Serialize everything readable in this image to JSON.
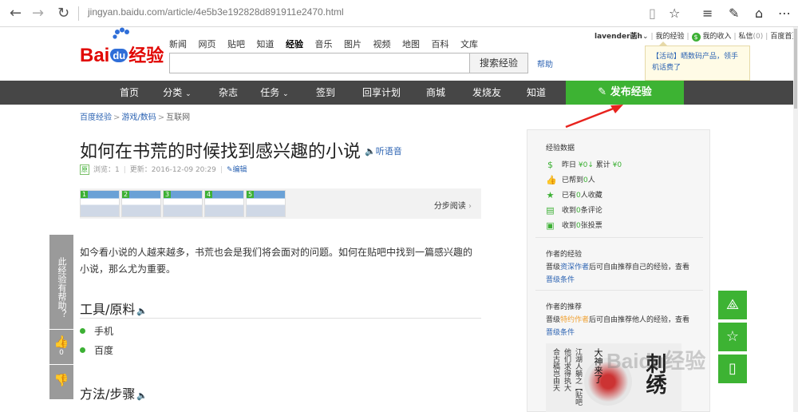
{
  "browser": {
    "url": "jingyan.baidu.com/article/4e5b3e192828d891911e2470.html"
  },
  "topnav": [
    "新闻",
    "网页",
    "贴吧",
    "知道",
    "经验",
    "音乐",
    "图片",
    "视频",
    "地图",
    "百科",
    "文库"
  ],
  "search": {
    "button": "搜索经验",
    "help": "帮助"
  },
  "logo": {
    "text_bai": "Bai",
    "text_du": "du",
    "text_jy": "经验"
  },
  "userbar": {
    "username": "lavender菡h",
    "my_experience": "我的经验",
    "my_income": "我的收入",
    "private_msg": "私信",
    "private_count": "(0)",
    "home": "百度首页"
  },
  "popup": {
    "text": "【活动】晒数码产品，领手机话费了"
  },
  "mainnav": {
    "items": [
      "首页",
      "分类",
      "杂志",
      "任务",
      "签到",
      "回享计划",
      "商城",
      "发烧友",
      "知道"
    ],
    "publish": "发布经验"
  },
  "breadcrumb": [
    "百度经验",
    "游戏/数码",
    "互联网"
  ],
  "article": {
    "title": "如何在书荒的时候找到感兴趣的小说",
    "listen": "听语音",
    "yuan": "原",
    "views": "浏览：1",
    "updated": "更新：2016-12-09 20:29",
    "edit": "编辑",
    "step_read": "分步阅读",
    "intro": "如今看小说的人越来越多，书荒也会是我们将会面对的问题。如何在贴吧中找到一篇感兴趣的小说，那么尤为重要。",
    "tools_title": "工具/原料",
    "tools": [
      "手机",
      "百度"
    ],
    "method_title": "方法/步骤"
  },
  "thumbs": [
    "1",
    "2",
    "3",
    "4",
    "5"
  ],
  "leftbar": {
    "question": "此经验有帮助？",
    "like_count": "0"
  },
  "sidebar": {
    "data_title": "经验数据",
    "yesterday_label": "昨日",
    "yesterday_value": "¥0",
    "total_label": "累计",
    "total_value": "¥0",
    "helped_pre": "已帮到",
    "helped_value": "0",
    "helped_post": "人",
    "collected_pre": "已有",
    "collected_value": "0",
    "collected_post": "人收藏",
    "comments_pre": "收到",
    "comments_value": "0",
    "comments_post": "条评论",
    "votes_pre": "收到",
    "votes_value": "0",
    "votes_post": "张投票",
    "author_title": "作者的经验",
    "author_text_pre": "晋级",
    "author_text_link": "资深作者",
    "author_text_post": "后可自由推荐自己的经验，查看",
    "author_link": "晋级条件",
    "recommend_title": "作者的推荐",
    "recommend_text_pre": "晋级",
    "recommend_text_link": "特约作者",
    "recommend_text_post": "后可自由推荐他人的经验，查看",
    "recommend_link": "晋级条件"
  },
  "ad": {
    "col1": "合古稿岂由天",
    "col2": "他们求得执大",
    "col3": "江湖人躺之【贴吧",
    "big": "刺绣",
    "banner": "大神来了"
  },
  "watermark": "Baidu经验"
}
